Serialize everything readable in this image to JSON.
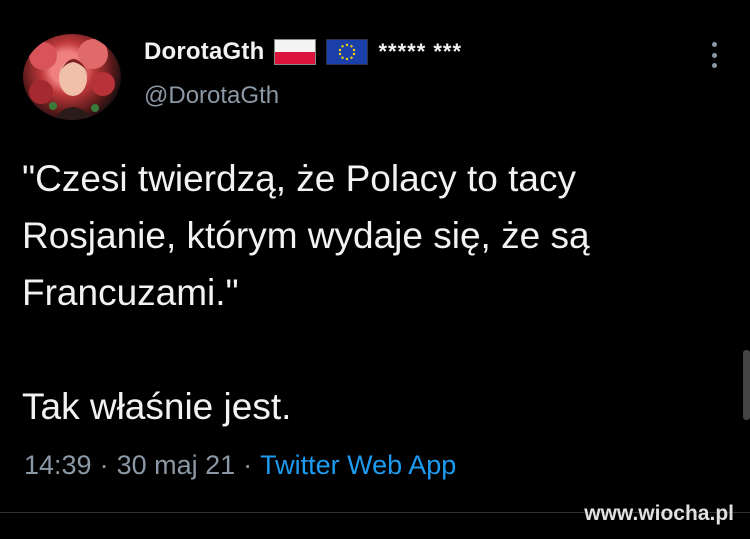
{
  "author": {
    "display_name": "DorotaGth",
    "name_suffix": "***** ***",
    "handle": "@DorotaGth",
    "avatar": "avatar-illustration"
  },
  "tweet": {
    "text": "\"Czesi twierdzą, że Polacy to tacy\nRosjanie, którym wydaje się, że są\nFrancuzami.\"\n\nTak właśnie jest.",
    "time": "14:39",
    "date": "30 maj 21",
    "source": "Twitter Web App",
    "separator": "·"
  },
  "icons": {
    "flag_pl": "poland-flag-icon",
    "flag_eu": "eu-flag-icon",
    "more": "more-options-icon"
  },
  "colors": {
    "background": "#000000",
    "muted": "#8b98a5",
    "link": "#1d9bf0"
  },
  "watermark": "www.wiocha.pl"
}
